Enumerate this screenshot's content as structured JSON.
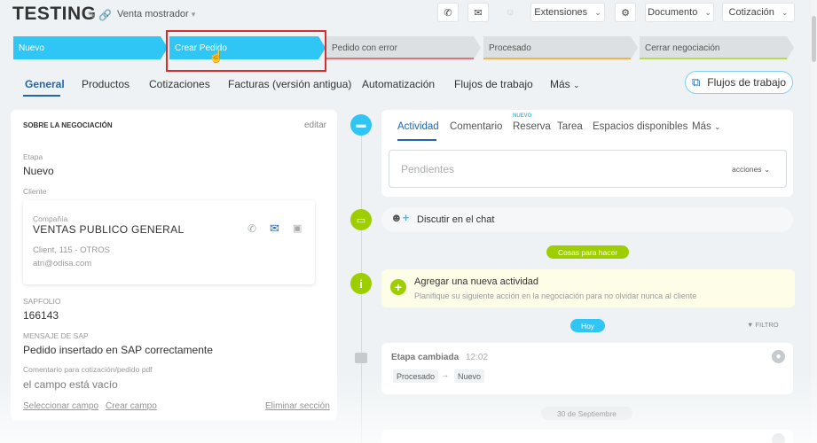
{
  "header": {
    "title": "TESTING",
    "deal_category": "Venta mostrador",
    "extensions_label": "Extensiones",
    "document_label": "Documento",
    "quote_label": "Cotización"
  },
  "stages": [
    {
      "label": "Nuevo",
      "color": "#2fc6f6"
    },
    {
      "label": "Crear Pedido",
      "color": "#2fc6f6"
    },
    {
      "label": "Pedido con error",
      "color": "#dde0e2",
      "underline": "#e57373"
    },
    {
      "label": "Procesado",
      "color": "#dde0e2",
      "underline": "#f2b34a"
    },
    {
      "label": "Cerrar negociación",
      "color": "#dde0e2",
      "underline": "#b7dc4b"
    }
  ],
  "tabs": {
    "general": "General",
    "productos": "Productos",
    "cotizaciones": "Cotizaciones",
    "facturas": "Facturas (versión antigua)",
    "automatizacion": "Automatización",
    "flujos": "Flujos de trabajo",
    "mas": "Más",
    "flujos_button": "Flujos de trabajo"
  },
  "about": {
    "title": "SOBRE LA NEGOCIACIÓN",
    "edit": "editar",
    "stage_label": "Etapa",
    "stage_value": "Nuevo",
    "client_label": "Cliente",
    "company_label": "Compañía",
    "company_name": "VENTAS PUBLICO GENERAL",
    "company_detail": "Client, 115 - OTROS",
    "company_email": "atn@odisa.com",
    "sapfolio_label": "SAPFOLIO",
    "sapfolio_value": "166143",
    "sap_msg_label": "MENSAJE DE SAP",
    "sap_msg_value": "Pedido insertado en SAP correctamente",
    "comment_label": "Comentario para cotización/pedido pdf",
    "comment_value": "el campo está vacío",
    "select_field": "Seleccionar campo",
    "create_field": "Crear campo",
    "delete_section": "Eliminar sección"
  },
  "activity": {
    "tabs": [
      "Actividad",
      "Comentario",
      "Reserva",
      "Tarea",
      "Espacios disponibles",
      "Más"
    ],
    "new_badge": "NUEVO",
    "pending_placeholder": "Pendientes",
    "actions_label": "acciones",
    "chat_label": "Discutir en el chat",
    "todo_pill": "Cosas para hacer",
    "todo_title": "Agregar una nueva actividad",
    "todo_subtitle": "Planifique su siguiente acción en la negociación para no olvidar nunca al cliente",
    "today_pill": "Hoy",
    "filter_label": "FILTRO",
    "stage_changed": "Etapa cambiada",
    "stage_changed_time": "12:02",
    "from_stage": "Procesado",
    "to_stage": "Nuevo",
    "date_pill": "30 de Septiembre"
  },
  "colors": {
    "accent_blue": "#2fc6f6",
    "link_blue": "#2067b0",
    "green": "#9dcf00",
    "highlight_red": "#d32f2f"
  }
}
